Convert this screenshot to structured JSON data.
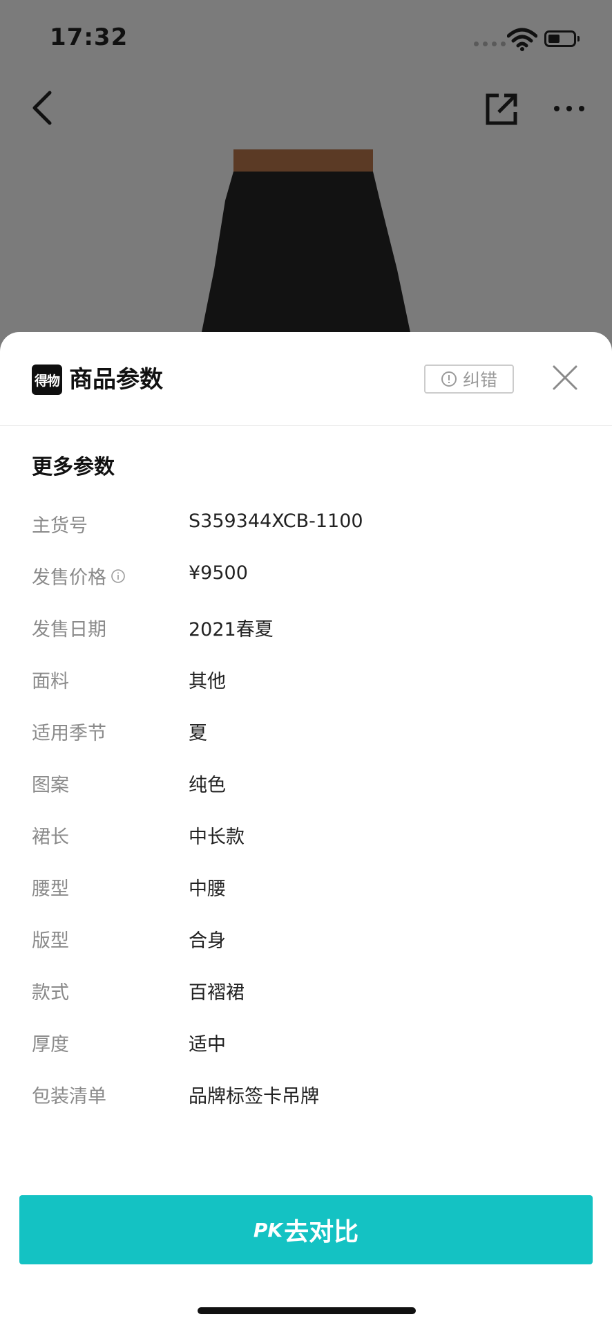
{
  "status_bar": {
    "time": "17:32"
  },
  "sheet": {
    "logo_text": "得物",
    "title": "商品参数",
    "report_label": "纠错",
    "section_title": "更多参数",
    "params": [
      {
        "label": "主货号",
        "value": "S359344XCB-1100"
      },
      {
        "label": "发售价格",
        "value": "¥9500"
      },
      {
        "label": "发售日期",
        "value": "2021春夏"
      },
      {
        "label": "面料",
        "value": "其他"
      },
      {
        "label": "适用季节",
        "value": "夏"
      },
      {
        "label": "图案",
        "value": "纯色"
      },
      {
        "label": "裙长",
        "value": "中长款"
      },
      {
        "label": "腰型",
        "value": "中腰"
      },
      {
        "label": "版型",
        "value": "合身"
      },
      {
        "label": "款式",
        "value": "百褶裙"
      },
      {
        "label": "厚度",
        "value": "适中"
      },
      {
        "label": "包装清单",
        "value": "品牌标签卡吊牌"
      }
    ]
  },
  "pk_button": {
    "prefix": "PK",
    "label": "去对比"
  },
  "colors": {
    "accent": "#14c2c3",
    "overlay": "#7b7b7b"
  },
  "icons": [
    "back-icon",
    "share-icon",
    "more-icon",
    "wifi-icon",
    "battery-icon",
    "report-icon",
    "close-icon",
    "info-icon"
  ]
}
